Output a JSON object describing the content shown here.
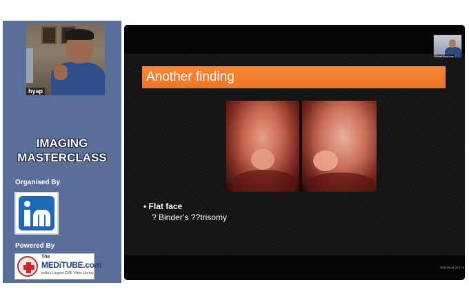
{
  "sidebar": {
    "webcam_name": "hyap",
    "title_line1": "IMAGING",
    "title_line2": "MASTERCLASS",
    "organised_label": "Organised By",
    "powered_label": "Powered By",
    "organiser_logo": "im-logo",
    "powered_logo": {
      "prefix": "The",
      "name": "MEDiTUBE.com",
      "tagline": "India's Largest CME Video Library"
    }
  },
  "slide": {
    "title": "Another finding",
    "bullet_1": "Flat face",
    "bullet_2": "? Binder’s ??trisomy",
    "image": "3d-fetal-ultrasound-image"
  },
  "pip": {
    "name": "Sonal Kashyap"
  },
  "timestamp": "2020-09-18 21:27:0",
  "colors": {
    "sidebar_bg": "#5a6e9a",
    "title_bar": "#ee7424",
    "slide_bg": "#141414",
    "brand_blue": "#1f68b4"
  }
}
